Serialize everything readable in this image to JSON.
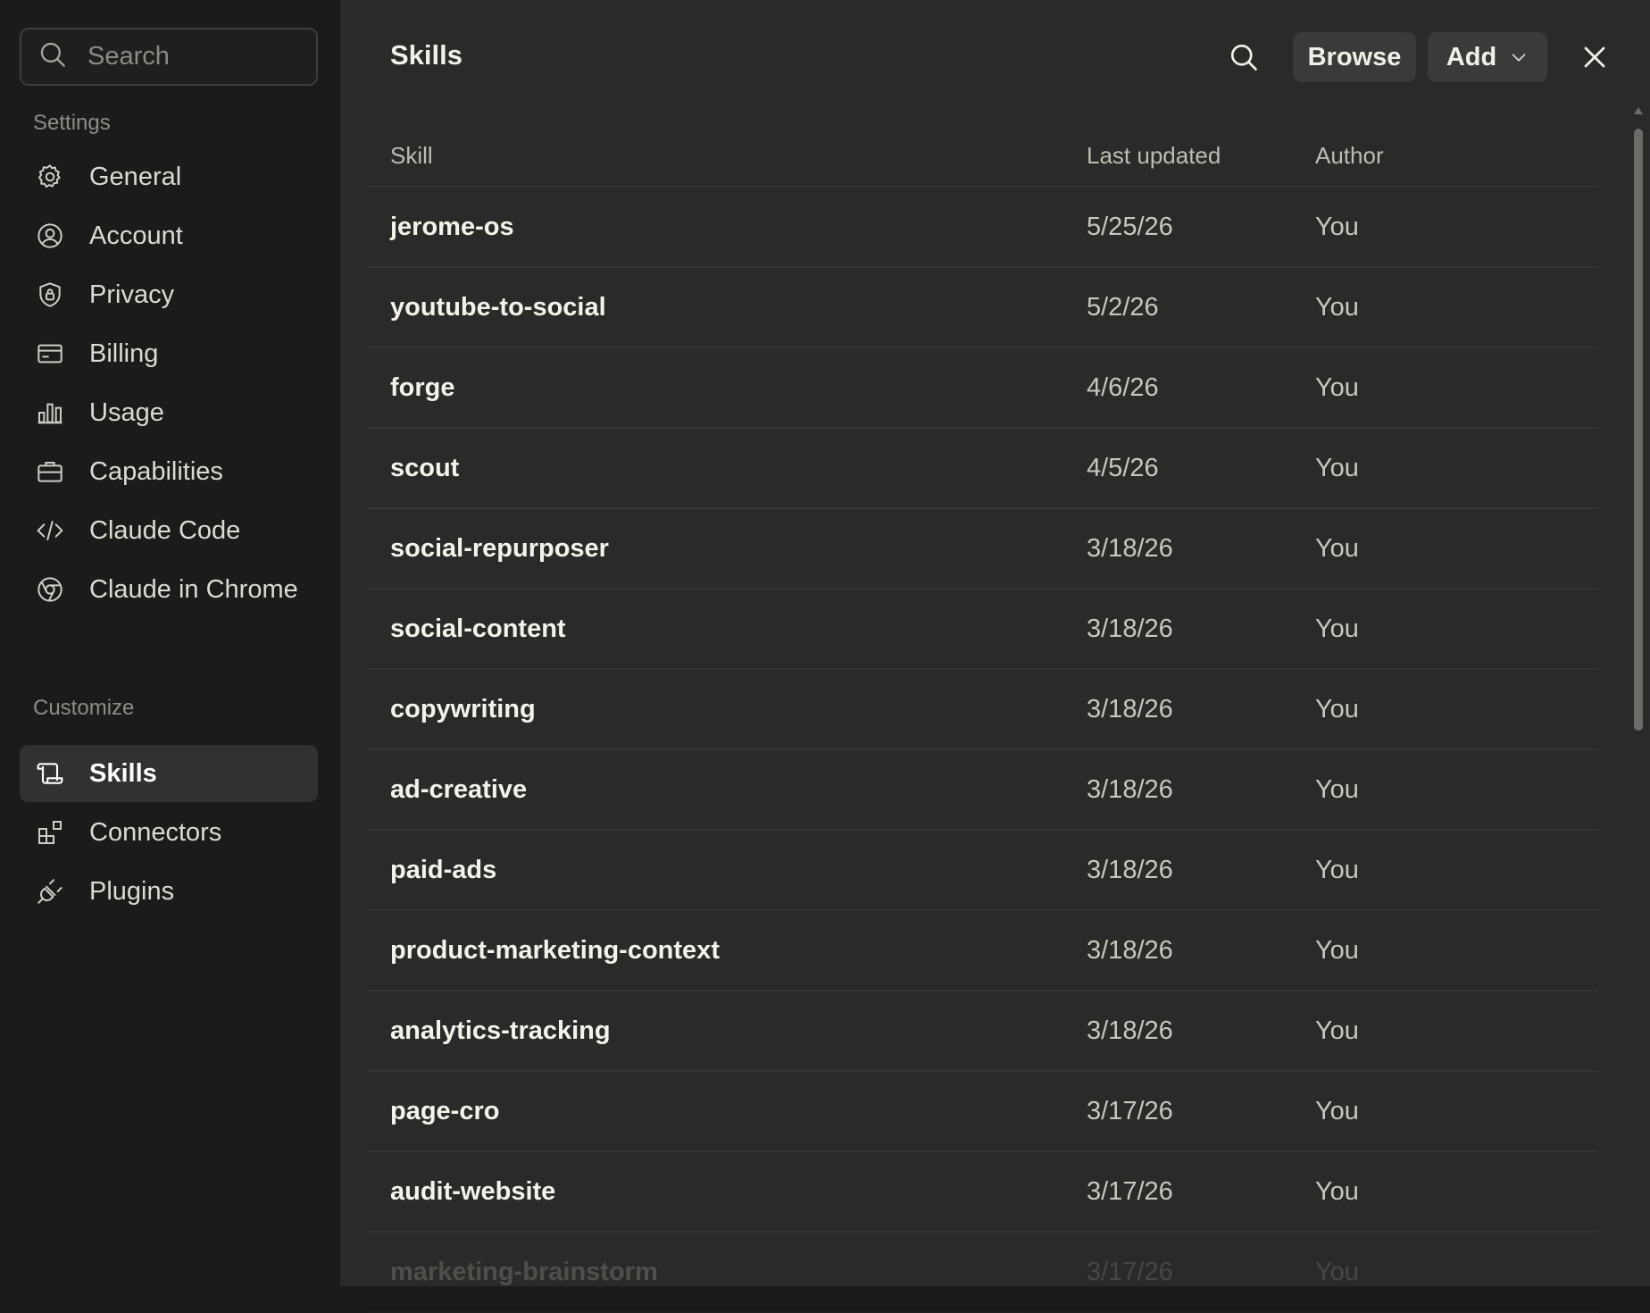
{
  "sidebar": {
    "search_placeholder": "Search",
    "settings_label": "Settings",
    "settings_items": [
      {
        "label": "General",
        "icon": "gear-icon"
      },
      {
        "label": "Account",
        "icon": "user-circle-icon"
      },
      {
        "label": "Privacy",
        "icon": "shield-lock-icon"
      },
      {
        "label": "Billing",
        "icon": "credit-card-icon"
      },
      {
        "label": "Usage",
        "icon": "bar-chart-icon"
      },
      {
        "label": "Capabilities",
        "icon": "briefcase-icon"
      },
      {
        "label": "Claude Code",
        "icon": "code-icon"
      },
      {
        "label": "Claude in Chrome",
        "icon": "globe-icon"
      }
    ],
    "customize_label": "Customize",
    "customize_items": [
      {
        "label": "Skills",
        "icon": "scroll-icon",
        "active": true
      },
      {
        "label": "Connectors",
        "icon": "grid-plus-icon"
      },
      {
        "label": "Plugins",
        "icon": "plug-icon"
      }
    ]
  },
  "header": {
    "title": "Skills",
    "search_icon": "search-icon",
    "browse_label": "Browse",
    "add_label": "Add",
    "close_icon": "close-icon"
  },
  "table": {
    "columns": {
      "skill": "Skill",
      "last_updated": "Last updated",
      "author": "Author"
    },
    "rows": [
      {
        "skill": "jerome-os",
        "date": "5/25/26",
        "author": "You"
      },
      {
        "skill": "youtube-to-social",
        "date": "5/2/26",
        "author": "You"
      },
      {
        "skill": "forge",
        "date": "4/6/26",
        "author": "You"
      },
      {
        "skill": "scout",
        "date": "4/5/26",
        "author": "You"
      },
      {
        "skill": "social-repurposer",
        "date": "3/18/26",
        "author": "You"
      },
      {
        "skill": "social-content",
        "date": "3/18/26",
        "author": "You"
      },
      {
        "skill": "copywriting",
        "date": "3/18/26",
        "author": "You"
      },
      {
        "skill": "ad-creative",
        "date": "3/18/26",
        "author": "You"
      },
      {
        "skill": "paid-ads",
        "date": "3/18/26",
        "author": "You"
      },
      {
        "skill": "product-marketing-context",
        "date": "3/18/26",
        "author": "You"
      },
      {
        "skill": "analytics-tracking",
        "date": "3/18/26",
        "author": "You"
      },
      {
        "skill": "page-cro",
        "date": "3/17/26",
        "author": "You"
      },
      {
        "skill": "audit-website",
        "date": "3/17/26",
        "author": "You"
      },
      {
        "skill": "marketing-brainstorm",
        "date": "3/17/26",
        "author": "You"
      }
    ]
  },
  "colors": {
    "sidebar_bg": "#1b1b1a",
    "main_bg": "#2a2a28",
    "active_item_bg": "#31312f",
    "button_bg": "#3a3a38"
  }
}
